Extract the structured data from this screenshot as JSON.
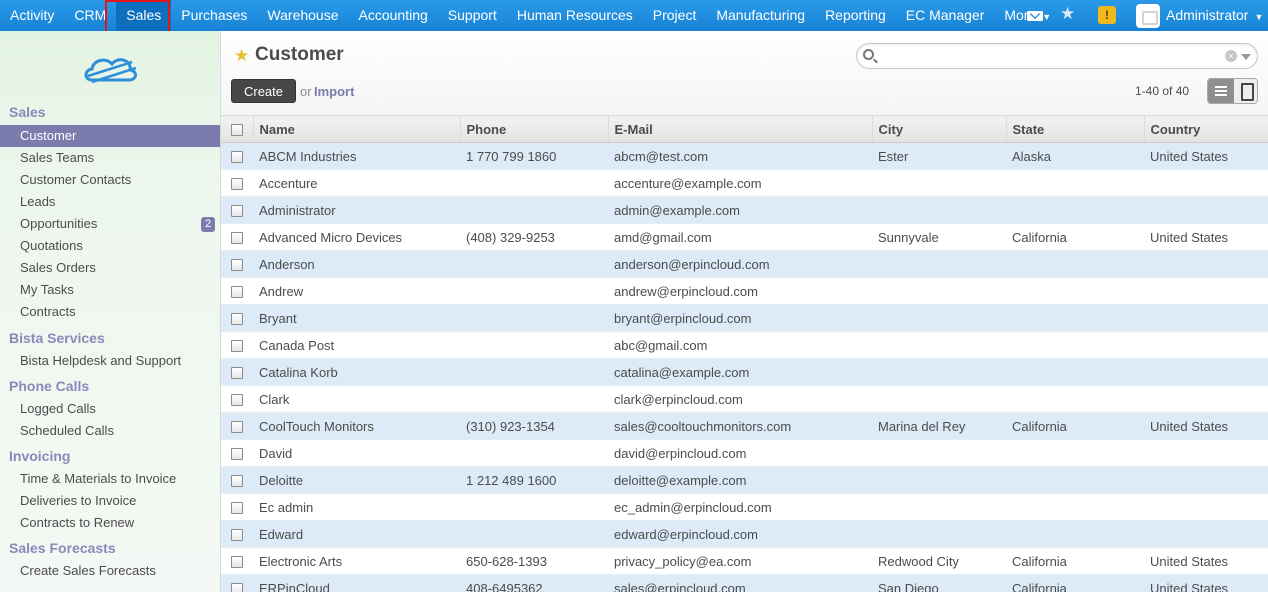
{
  "nav": {
    "items": [
      "Activity",
      "CRM",
      "Sales",
      "Purchases",
      "Warehouse",
      "Accounting",
      "Support",
      "Human Resources",
      "Project",
      "Manufacturing",
      "Reporting",
      "EC Manager",
      "More"
    ],
    "active": "Sales",
    "user": "Administrator",
    "alert_glyph": "!"
  },
  "sidebar": {
    "sections": [
      {
        "title": "Sales",
        "items": [
          "Customer",
          "Sales Teams",
          "Customer Contacts",
          "Leads",
          "Opportunities",
          "Quotations",
          "Sales Orders",
          "My Tasks",
          "Contracts"
        ]
      },
      {
        "title": "Bista Services",
        "items": [
          "Bista Helpdesk and Support"
        ]
      },
      {
        "title": "Phone Calls",
        "items": [
          "Logged Calls",
          "Scheduled Calls"
        ]
      },
      {
        "title": "Invoicing",
        "items": [
          "Time & Materials to Invoice",
          "Deliveries to Invoice",
          "Contracts to Renew"
        ]
      },
      {
        "title": "Sales Forecasts",
        "items": [
          "Create Sales Forecasts"
        ]
      }
    ],
    "active_item": "Customer",
    "opportunities_badge": "2"
  },
  "header": {
    "title": "Customer",
    "create_label": "Create",
    "or_label": "or",
    "import_label": "Import",
    "pager": "1-40 of 40",
    "search_value": "",
    "clear_glyph": "×"
  },
  "table": {
    "columns": [
      "Name",
      "Phone",
      "E-Mail",
      "City",
      "State",
      "Country"
    ],
    "rows": [
      [
        "ABCM Industries",
        "1 770 799 1860",
        "abcm@test.com",
        "Ester",
        "Alaska",
        "United States"
      ],
      [
        "Accenture",
        "",
        "accenture@example.com",
        "",
        "",
        ""
      ],
      [
        "Administrator",
        "",
        "admin@example.com",
        "",
        "",
        ""
      ],
      [
        "Advanced Micro Devices",
        "(408) 329-9253",
        "amd@gmail.com",
        "Sunnyvale",
        "California",
        "United States"
      ],
      [
        "Anderson",
        "",
        "anderson@erpincloud.com",
        "",
        "",
        ""
      ],
      [
        "Andrew",
        "",
        "andrew@erpincloud.com",
        "",
        "",
        ""
      ],
      [
        "Bryant",
        "",
        "bryant@erpincloud.com",
        "",
        "",
        ""
      ],
      [
        "Canada Post",
        "",
        "abc@gmail.com",
        "",
        "",
        ""
      ],
      [
        "Catalina Korb",
        "",
        "catalina@example.com",
        "",
        "",
        ""
      ],
      [
        "Clark",
        "",
        "clark@erpincloud.com",
        "",
        "",
        ""
      ],
      [
        "CoolTouch Monitors",
        "(310) 923-1354",
        "sales@cooltouchmonitors.com",
        "Marina del Rey",
        "California",
        "United States"
      ],
      [
        "David",
        "",
        "david@erpincloud.com",
        "",
        "",
        ""
      ],
      [
        "Deloitte",
        "1 212 489 1600",
        "deloitte@example.com",
        "",
        "",
        ""
      ],
      [
        "Ec admin",
        "",
        "ec_admin@erpincloud.com",
        "",
        "",
        ""
      ],
      [
        "Edward",
        "",
        "edward@erpincloud.com",
        "",
        "",
        ""
      ],
      [
        "Electronic Arts",
        "650-628-1393",
        "privacy_policy@ea.com",
        "Redwood City",
        "California",
        "United States"
      ],
      [
        "ERPinCloud",
        "408-6495362",
        "sales@erpincloud.com",
        "San Diego",
        "California",
        "United States"
      ]
    ]
  }
}
